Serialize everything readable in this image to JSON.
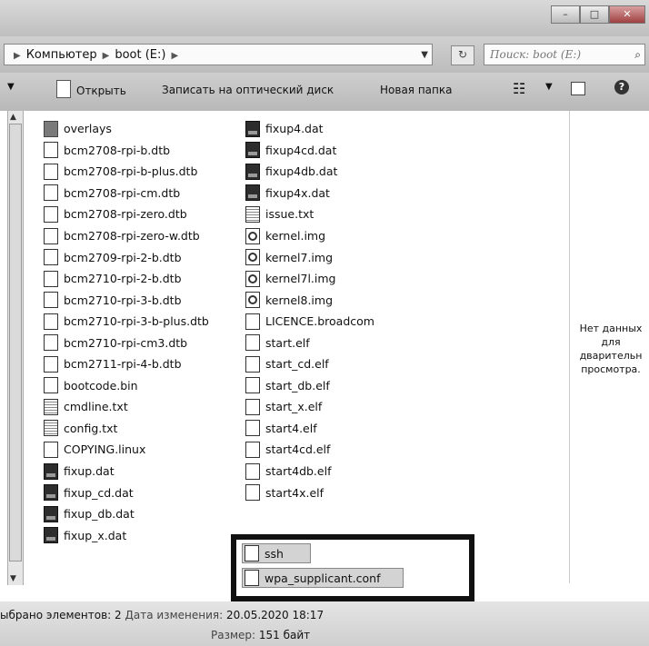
{
  "window": {
    "min_glyph": "–",
    "max_glyph": "□",
    "close_glyph": "✕"
  },
  "address": {
    "crumbs": [
      "Компьютер",
      "boot (E:)"
    ],
    "search_placeholder": "Поиск: boot (E:)"
  },
  "toolbar": {
    "open_label": "Открыть",
    "burn_label": "Записать на оптический диск",
    "new_folder_label": "Новая папка"
  },
  "files": {
    "column1": [
      {
        "name": "overlays",
        "icon": "folder-icon"
      },
      {
        "name": "bcm2708-rpi-b.dtb",
        "icon": "file-icon"
      },
      {
        "name": "bcm2708-rpi-b-plus.dtb",
        "icon": "file-icon"
      },
      {
        "name": "bcm2708-rpi-cm.dtb",
        "icon": "file-icon"
      },
      {
        "name": "bcm2708-rpi-zero.dtb",
        "icon": "file-icon"
      },
      {
        "name": "bcm2708-rpi-zero-w.dtb",
        "icon": "file-icon"
      },
      {
        "name": "bcm2709-rpi-2-b.dtb",
        "icon": "file-icon"
      },
      {
        "name": "bcm2710-rpi-2-b.dtb",
        "icon": "file-icon"
      },
      {
        "name": "bcm2710-rpi-3-b.dtb",
        "icon": "file-icon"
      },
      {
        "name": "bcm2710-rpi-3-b-plus.dtb",
        "icon": "file-icon"
      },
      {
        "name": "bcm2710-rpi-cm3.dtb",
        "icon": "file-icon"
      },
      {
        "name": "bcm2711-rpi-4-b.dtb",
        "icon": "file-icon"
      },
      {
        "name": "bootcode.bin",
        "icon": "file-icon"
      },
      {
        "name": "cmdline.txt",
        "icon": "text-file-icon"
      },
      {
        "name": "config.txt",
        "icon": "text-file-icon"
      },
      {
        "name": "COPYING.linux",
        "icon": "file-icon"
      },
      {
        "name": "fixup.dat",
        "icon": "dat-file-icon"
      },
      {
        "name": "fixup_cd.dat",
        "icon": "dat-file-icon"
      },
      {
        "name": "fixup_db.dat",
        "icon": "dat-file-icon"
      },
      {
        "name": "fixup_x.dat",
        "icon": "dat-file-icon"
      }
    ],
    "column2": [
      {
        "name": "fixup4.dat",
        "icon": "dat-file-icon"
      },
      {
        "name": "fixup4cd.dat",
        "icon": "dat-file-icon"
      },
      {
        "name": "fixup4db.dat",
        "icon": "dat-file-icon"
      },
      {
        "name": "fixup4x.dat",
        "icon": "dat-file-icon"
      },
      {
        "name": "issue.txt",
        "icon": "text-file-icon"
      },
      {
        "name": "kernel.img",
        "icon": "disk-image-icon"
      },
      {
        "name": "kernel7.img",
        "icon": "disk-image-icon"
      },
      {
        "name": "kernel7l.img",
        "icon": "disk-image-icon"
      },
      {
        "name": "kernel8.img",
        "icon": "disk-image-icon"
      },
      {
        "name": "LICENCE.broadcom",
        "icon": "file-icon"
      },
      {
        "name": "start.elf",
        "icon": "file-icon"
      },
      {
        "name": "start_cd.elf",
        "icon": "file-icon"
      },
      {
        "name": "start_db.elf",
        "icon": "file-icon"
      },
      {
        "name": "start_x.elf",
        "icon": "file-icon"
      },
      {
        "name": "start4.elf",
        "icon": "file-icon"
      },
      {
        "name": "start4cd.elf",
        "icon": "file-icon"
      },
      {
        "name": "start4db.elf",
        "icon": "file-icon"
      },
      {
        "name": "start4x.elf",
        "icon": "file-icon"
      }
    ],
    "selected": [
      {
        "name": "ssh",
        "icon": "file-icon"
      },
      {
        "name": "wpa_supplicant.conf",
        "icon": "file-icon"
      }
    ]
  },
  "preview": {
    "text": "Нет данных для дварительн просмотра."
  },
  "status": {
    "selected_count": "ыбрано элементов: 2",
    "modified_label": "Дата изменения:",
    "modified_value": "20.05.2020 18:17",
    "size_label": "Размер:",
    "size_value": "151 байт"
  }
}
